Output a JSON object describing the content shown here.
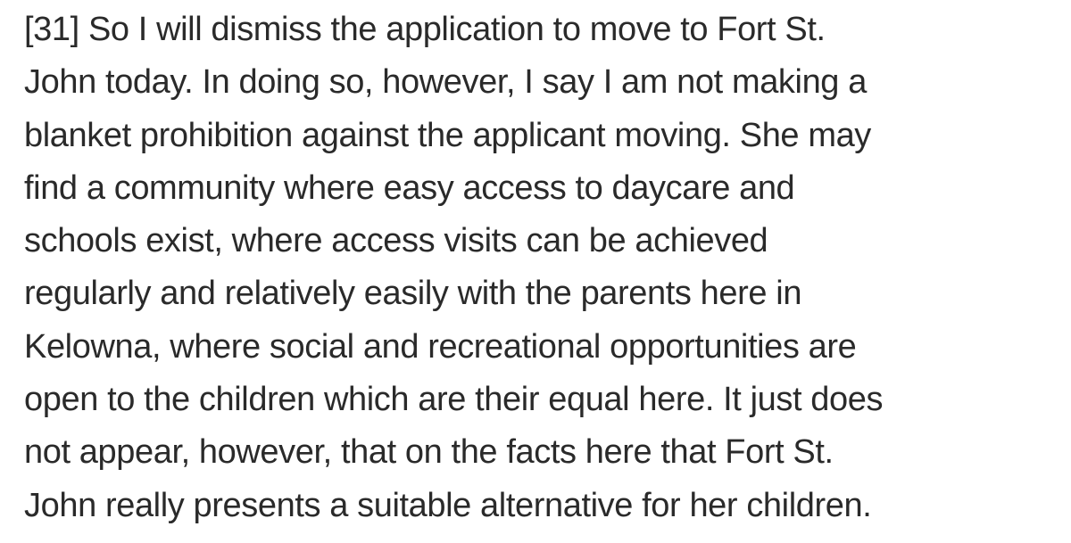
{
  "document": {
    "paragraph_lines": [
      "[31] So I will dismiss the application to move to Fort St.",
      "John today. In doing so, however, I say I am not making a",
      "blanket prohibition against the applicant moving. She may",
      "find a community where easy access to daycare and",
      "schools exist, where access visits can be achieved",
      "regularly and relatively easily with the parents here in",
      "Kelowna, where social and recreational opportunities are",
      "open to the children which are their equal here. It just does",
      "not appear, however, that on the facts here that Fort St.",
      "John really presents a suitable alternative for her children."
    ]
  },
  "colors": {
    "background": "#ffffff",
    "text": "#2a2a2a"
  }
}
